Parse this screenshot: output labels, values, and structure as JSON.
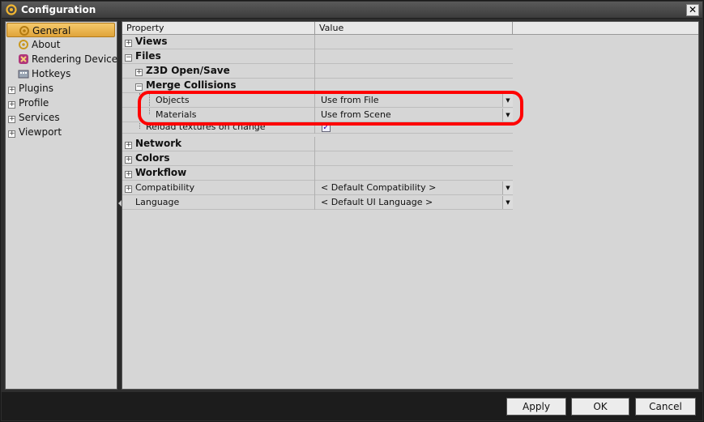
{
  "window": {
    "title": "Configuration",
    "close_label": "✕"
  },
  "sidebar": {
    "items": [
      {
        "label": "General",
        "icon": "gear-icon",
        "selected": true
      },
      {
        "label": "About",
        "icon": "gear-icon"
      },
      {
        "label": "Rendering Device",
        "icon": "render-icon"
      },
      {
        "label": "Hotkeys",
        "icon": "keyboard-icon"
      },
      {
        "label": "Plugins",
        "expander": "+"
      },
      {
        "label": "Profile",
        "expander": "+"
      },
      {
        "label": "Services",
        "expander": "+"
      },
      {
        "label": "Viewport",
        "expander": "+"
      }
    ]
  },
  "grid": {
    "headers": {
      "property": "Property",
      "value": "Value"
    },
    "rows": [
      {
        "property": "Views",
        "value": "",
        "expander": "+",
        "bold": true
      },
      {
        "property": "Files",
        "value": "",
        "expander": "−",
        "bold": true
      },
      {
        "property": "Z3D Open/Save",
        "value": "",
        "expander": "+",
        "bold": true
      },
      {
        "property": "Merge Collisions",
        "value": "",
        "expander": "−",
        "bold": true
      },
      {
        "property": "Objects",
        "value": "Use from File",
        "dropdown": true
      },
      {
        "property": "Materials",
        "value": "Use from Scene",
        "dropdown": true
      },
      {
        "property": "Reload textures on change",
        "value": "",
        "checkbox": true,
        "checked": true
      },
      {
        "property": "Network",
        "value": "",
        "expander": "+",
        "bold": true
      },
      {
        "property": "Colors",
        "value": "",
        "expander": "+",
        "bold": true
      },
      {
        "property": "Workflow",
        "value": "",
        "expander": "+",
        "bold": true
      },
      {
        "property": "Compatibility",
        "value": "< Default Compatibility >",
        "expander": "+",
        "dropdown": true
      },
      {
        "property": "Language",
        "value": "< Default UI Language >",
        "dropdown": true
      }
    ],
    "checkbox_mark": "✓",
    "dropdown_glyph": "▼"
  },
  "buttons": {
    "apply": "Apply",
    "ok": "OK",
    "cancel": "Cancel"
  },
  "colors": {
    "highlight": "#ff0000",
    "selected": "#e0a43a"
  }
}
